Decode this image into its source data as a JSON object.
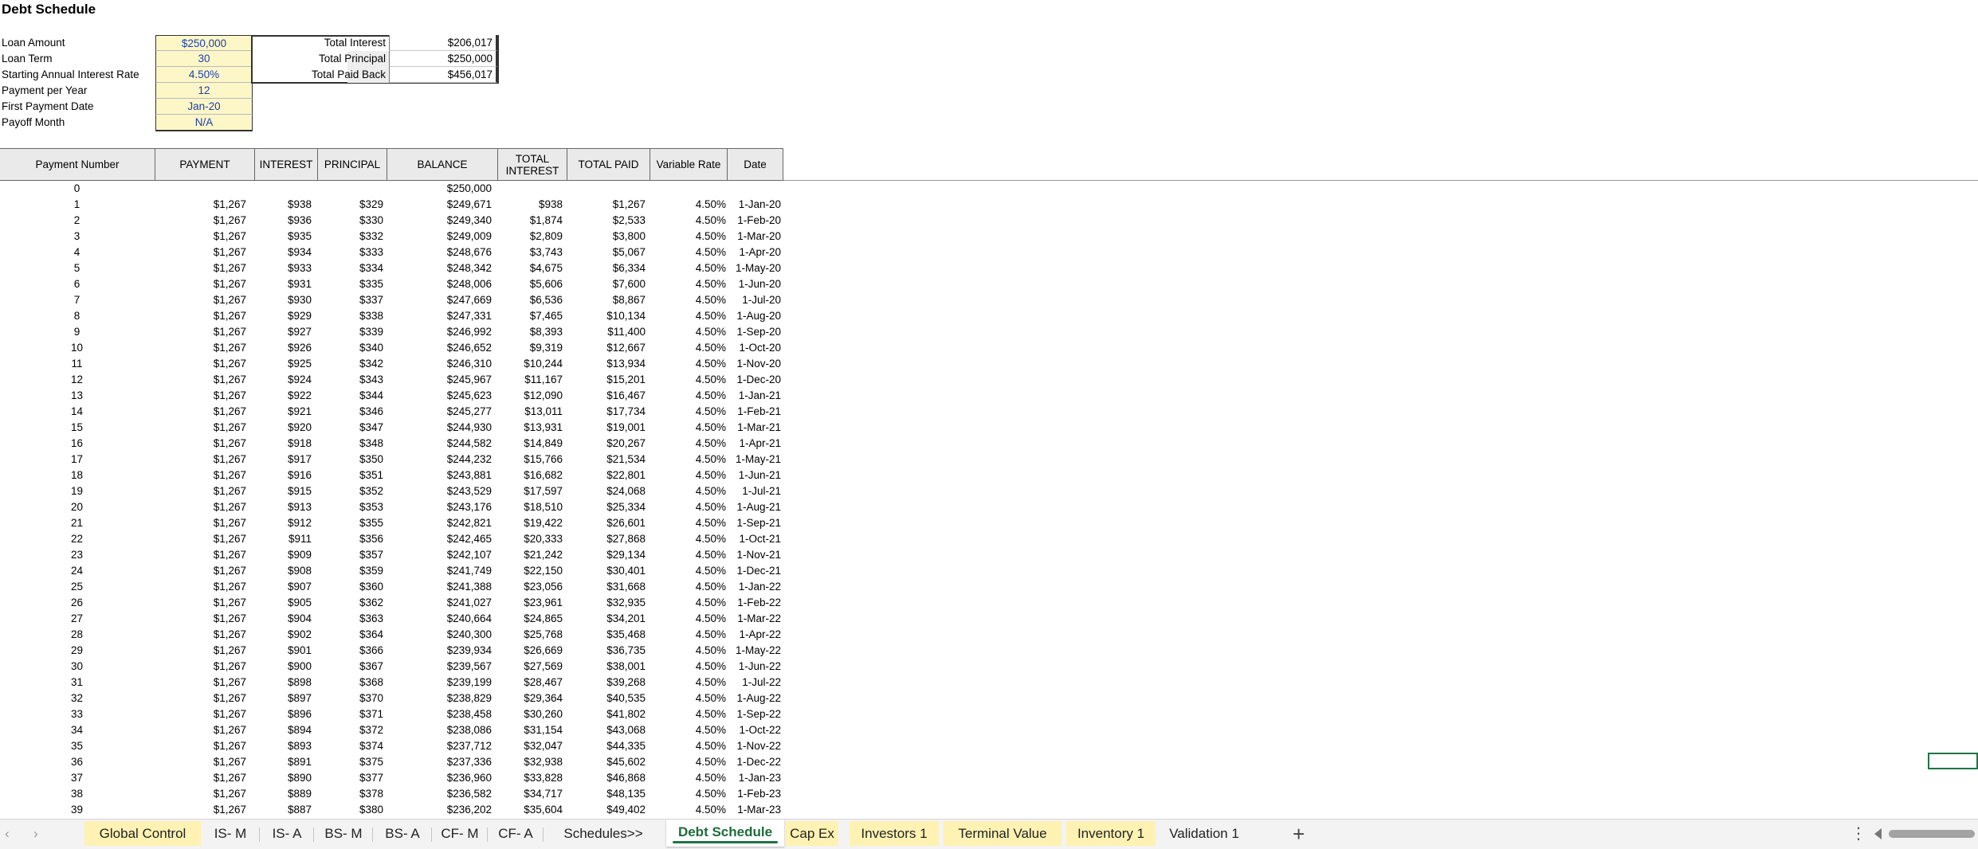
{
  "title": "Debt Schedule",
  "inputs": [
    {
      "label": "Loan Amount",
      "value": "$250,000"
    },
    {
      "label": "Loan Term",
      "value": "30"
    },
    {
      "label": "Starting Annual Interest Rate",
      "value": "4.50%"
    },
    {
      "label": "Payment per Year",
      "value": "12"
    },
    {
      "label": "First Payment Date",
      "value": "Jan-20"
    },
    {
      "label": "Payoff Month",
      "value": "N/A"
    }
  ],
  "summary": [
    {
      "label": "Total Interest",
      "value": "$206,017"
    },
    {
      "label": "Total Principal",
      "value": "$250,000"
    },
    {
      "label": "Total Paid Back",
      "value": "$456,017"
    }
  ],
  "table": {
    "headers": [
      "Payment Number",
      "PAYMENT",
      "INTEREST",
      "PRINCIPAL",
      "BALANCE",
      "TOTAL INTEREST",
      "TOTAL PAID",
      "Variable  Rate",
      "Date"
    ],
    "rows": [
      [
        "0",
        "",
        "",
        "",
        "$250,000",
        "",
        "",
        "",
        ""
      ],
      [
        "1",
        "$1,267",
        "$938",
        "$329",
        "$249,671",
        "$938",
        "$1,267",
        "4.50%",
        "1-Jan-20"
      ],
      [
        "2",
        "$1,267",
        "$936",
        "$330",
        "$249,340",
        "$1,874",
        "$2,533",
        "4.50%",
        "1-Feb-20"
      ],
      [
        "3",
        "$1,267",
        "$935",
        "$332",
        "$249,009",
        "$2,809",
        "$3,800",
        "4.50%",
        "1-Mar-20"
      ],
      [
        "4",
        "$1,267",
        "$934",
        "$333",
        "$248,676",
        "$3,743",
        "$5,067",
        "4.50%",
        "1-Apr-20"
      ],
      [
        "5",
        "$1,267",
        "$933",
        "$334",
        "$248,342",
        "$4,675",
        "$6,334",
        "4.50%",
        "1-May-20"
      ],
      [
        "6",
        "$1,267",
        "$931",
        "$335",
        "$248,006",
        "$5,606",
        "$7,600",
        "4.50%",
        "1-Jun-20"
      ],
      [
        "7",
        "$1,267",
        "$930",
        "$337",
        "$247,669",
        "$6,536",
        "$8,867",
        "4.50%",
        "1-Jul-20"
      ],
      [
        "8",
        "$1,267",
        "$929",
        "$338",
        "$247,331",
        "$7,465",
        "$10,134",
        "4.50%",
        "1-Aug-20"
      ],
      [
        "9",
        "$1,267",
        "$927",
        "$339",
        "$246,992",
        "$8,393",
        "$11,400",
        "4.50%",
        "1-Sep-20"
      ],
      [
        "10",
        "$1,267",
        "$926",
        "$340",
        "$246,652",
        "$9,319",
        "$12,667",
        "4.50%",
        "1-Oct-20"
      ],
      [
        "11",
        "$1,267",
        "$925",
        "$342",
        "$246,310",
        "$10,244",
        "$13,934",
        "4.50%",
        "1-Nov-20"
      ],
      [
        "12",
        "$1,267",
        "$924",
        "$343",
        "$245,967",
        "$11,167",
        "$15,201",
        "4.50%",
        "1-Dec-20"
      ],
      [
        "13",
        "$1,267",
        "$922",
        "$344",
        "$245,623",
        "$12,090",
        "$16,467",
        "4.50%",
        "1-Jan-21"
      ],
      [
        "14",
        "$1,267",
        "$921",
        "$346",
        "$245,277",
        "$13,011",
        "$17,734",
        "4.50%",
        "1-Feb-21"
      ],
      [
        "15",
        "$1,267",
        "$920",
        "$347",
        "$244,930",
        "$13,931",
        "$19,001",
        "4.50%",
        "1-Mar-21"
      ],
      [
        "16",
        "$1,267",
        "$918",
        "$348",
        "$244,582",
        "$14,849",
        "$20,267",
        "4.50%",
        "1-Apr-21"
      ],
      [
        "17",
        "$1,267",
        "$917",
        "$350",
        "$244,232",
        "$15,766",
        "$21,534",
        "4.50%",
        "1-May-21"
      ],
      [
        "18",
        "$1,267",
        "$916",
        "$351",
        "$243,881",
        "$16,682",
        "$22,801",
        "4.50%",
        "1-Jun-21"
      ],
      [
        "19",
        "$1,267",
        "$915",
        "$352",
        "$243,529",
        "$17,597",
        "$24,068",
        "4.50%",
        "1-Jul-21"
      ],
      [
        "20",
        "$1,267",
        "$913",
        "$353",
        "$243,176",
        "$18,510",
        "$25,334",
        "4.50%",
        "1-Aug-21"
      ],
      [
        "21",
        "$1,267",
        "$912",
        "$355",
        "$242,821",
        "$19,422",
        "$26,601",
        "4.50%",
        "1-Sep-21"
      ],
      [
        "22",
        "$1,267",
        "$911",
        "$356",
        "$242,465",
        "$20,333",
        "$27,868",
        "4.50%",
        "1-Oct-21"
      ],
      [
        "23",
        "$1,267",
        "$909",
        "$357",
        "$242,107",
        "$21,242",
        "$29,134",
        "4.50%",
        "1-Nov-21"
      ],
      [
        "24",
        "$1,267",
        "$908",
        "$359",
        "$241,749",
        "$22,150",
        "$30,401",
        "4.50%",
        "1-Dec-21"
      ],
      [
        "25",
        "$1,267",
        "$907",
        "$360",
        "$241,388",
        "$23,056",
        "$31,668",
        "4.50%",
        "1-Jan-22"
      ],
      [
        "26",
        "$1,267",
        "$905",
        "$362",
        "$241,027",
        "$23,961",
        "$32,935",
        "4.50%",
        "1-Feb-22"
      ],
      [
        "27",
        "$1,267",
        "$904",
        "$363",
        "$240,664",
        "$24,865",
        "$34,201",
        "4.50%",
        "1-Mar-22"
      ],
      [
        "28",
        "$1,267",
        "$902",
        "$364",
        "$240,300",
        "$25,768",
        "$35,468",
        "4.50%",
        "1-Apr-22"
      ],
      [
        "29",
        "$1,267",
        "$901",
        "$366",
        "$239,934",
        "$26,669",
        "$36,735",
        "4.50%",
        "1-May-22"
      ],
      [
        "30",
        "$1,267",
        "$900",
        "$367",
        "$239,567",
        "$27,569",
        "$38,001",
        "4.50%",
        "1-Jun-22"
      ],
      [
        "31",
        "$1,267",
        "$898",
        "$368",
        "$239,199",
        "$28,467",
        "$39,268",
        "4.50%",
        "1-Jul-22"
      ],
      [
        "32",
        "$1,267",
        "$897",
        "$370",
        "$238,829",
        "$29,364",
        "$40,535",
        "4.50%",
        "1-Aug-22"
      ],
      [
        "33",
        "$1,267",
        "$896",
        "$371",
        "$238,458",
        "$30,260",
        "$41,802",
        "4.50%",
        "1-Sep-22"
      ],
      [
        "34",
        "$1,267",
        "$894",
        "$372",
        "$238,086",
        "$31,154",
        "$43,068",
        "4.50%",
        "1-Oct-22"
      ],
      [
        "35",
        "$1,267",
        "$893",
        "$374",
        "$237,712",
        "$32,047",
        "$44,335",
        "4.50%",
        "1-Nov-22"
      ],
      [
        "36",
        "$1,267",
        "$891",
        "$375",
        "$237,336",
        "$32,938",
        "$45,602",
        "4.50%",
        "1-Dec-22"
      ],
      [
        "37",
        "$1,267",
        "$890",
        "$377",
        "$236,960",
        "$33,828",
        "$46,868",
        "4.50%",
        "1-Jan-23"
      ],
      [
        "38",
        "$1,267",
        "$889",
        "$378",
        "$236,582",
        "$34,717",
        "$48,135",
        "4.50%",
        "1-Feb-23"
      ],
      [
        "39",
        "$1,267",
        "$887",
        "$380",
        "$236,202",
        "$35,604",
        "$49,402",
        "4.50%",
        "1-Mar-23"
      ]
    ]
  },
  "tabs": [
    {
      "label": "Global Control",
      "style": "yellow"
    },
    {
      "label": "IS- M",
      "style": "plain"
    },
    {
      "label": "IS- A",
      "style": "plain"
    },
    {
      "label": "BS- M",
      "style": "plain"
    },
    {
      "label": "BS- A",
      "style": "plain"
    },
    {
      "label": "CF- M",
      "style": "plain"
    },
    {
      "label": "CF- A",
      "style": "plain"
    },
    {
      "label": "Schedules>>",
      "style": "plain"
    },
    {
      "label": "Debt Schedule",
      "style": "active"
    },
    {
      "label": "Cap Ex",
      "style": "yellow"
    },
    {
      "label": "Investors 1",
      "style": "yellow"
    },
    {
      "label": "Terminal Value",
      "style": "yellow"
    },
    {
      "label": "Inventory 1",
      "style": "yellow"
    },
    {
      "label": "Validation 1",
      "style": "plain"
    }
  ],
  "icons": {
    "prev": "‹",
    "next": "›",
    "add": "+",
    "more": "⋮"
  }
}
